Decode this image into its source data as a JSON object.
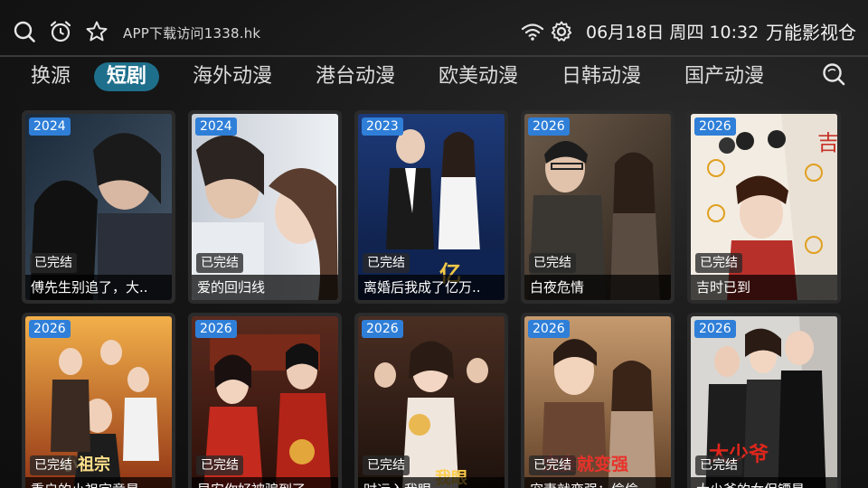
{
  "topbar": {
    "app_url": "APP下载访问1338.hk",
    "datetime": "06月18日 周四 10:32",
    "brand": "万能影视仓",
    "icons": [
      "search-icon",
      "alarm-clock-icon",
      "star-icon",
      "wifi-icon",
      "gear-icon"
    ]
  },
  "tabs": [
    {
      "label": "换源",
      "active": false
    },
    {
      "label": "短剧",
      "active": true
    },
    {
      "label": "海外动漫",
      "active": false
    },
    {
      "label": "港台动漫",
      "active": false
    },
    {
      "label": "欧美动漫",
      "active": false
    },
    {
      "label": "日韩动漫",
      "active": false
    },
    {
      "label": "国产动漫",
      "active": false
    }
  ],
  "colors": {
    "active_tab": "#1e6f8c",
    "year_badge": "#2f7fd8",
    "background": "#141414"
  },
  "cards": [
    {
      "year": "2024",
      "status": "已完结",
      "title": "傅先生别追了，大.."
    },
    {
      "year": "2024",
      "status": "已完结",
      "title": "爱的回归线"
    },
    {
      "year": "2023",
      "status": "已完结",
      "title": "离婚后我成了亿万.."
    },
    {
      "year": "2026",
      "status": "已完结",
      "title": "白夜危情"
    },
    {
      "year": "2026",
      "status": "已完结",
      "title": "吉时已到"
    },
    {
      "year": "2026",
      "status": "已完结",
      "title": "重启的小祖宗竟是.."
    },
    {
      "year": "2026",
      "status": "已完结",
      "title": "早安你好被骗到了"
    },
    {
      "year": "2026",
      "status": "已完结",
      "title": "时运入我眼"
    },
    {
      "year": "2026",
      "status": "已完结",
      "title": "宠妻就变强：偷偷.."
    },
    {
      "year": "2026",
      "status": "已完结",
      "title": "大少爷的女保镖是.."
    }
  ]
}
